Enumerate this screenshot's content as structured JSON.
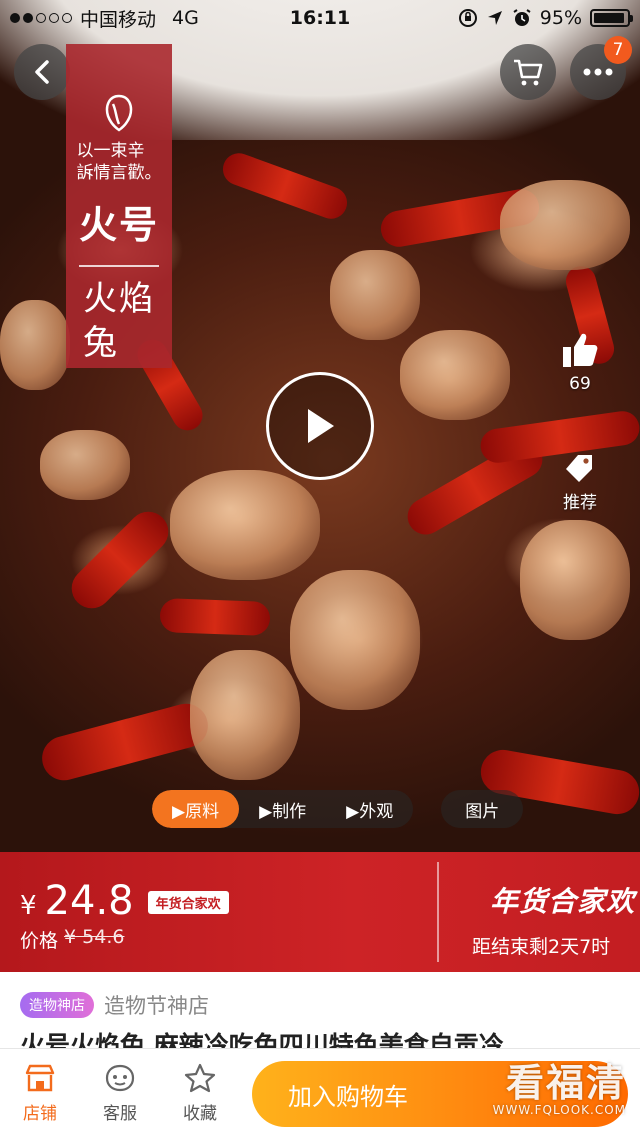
{
  "status_bar": {
    "carrier": "中国移动",
    "network": "4G",
    "time": "16:11",
    "battery": "95%",
    "battery_level": 0.95,
    "signal_bars": 2
  },
  "nav": {
    "back_icon": "chevron-left-icon",
    "cart_icon": "shopping-cart-icon",
    "more_icon": "more-dots-icon",
    "more_badge": "7"
  },
  "brand": {
    "slogan_line1": "以一束辛",
    "slogan_line2": "訴情言歡。",
    "name": "火号",
    "product_line1": "火焰",
    "product_line2": "兔"
  },
  "side_actions": {
    "like_count": "69",
    "recommend_label": "推荐"
  },
  "media_tabs": {
    "items": [
      "▶原料",
      "▶制作",
      "▶外观"
    ],
    "photos": "图片",
    "active_index": 0
  },
  "price": {
    "currency": "¥",
    "value": "24.8",
    "promo_chip": "年货合家欢",
    "original_label": "价格",
    "original_value": "¥ 54.6",
    "festival_logo": "年货合家欢",
    "countdown": "距结束剩2天7时"
  },
  "shop": {
    "tag": "造物神店",
    "name": "造物节神店"
  },
  "product": {
    "title": "火号火焰兔 麻辣冷吃兔四川特色美食自贡冷"
  },
  "bottom_bar": {
    "store_label": "店铺",
    "service_label": "客服",
    "favorite_label": "收藏",
    "add_to_cart": "加入购物车"
  },
  "watermark": {
    "main": "看福清",
    "sub": "WWW.FQLOOK.COM"
  },
  "colors": {
    "accent_orange": "#f3741f",
    "price_red": "#c41e22",
    "badge": "#f25a1e"
  }
}
